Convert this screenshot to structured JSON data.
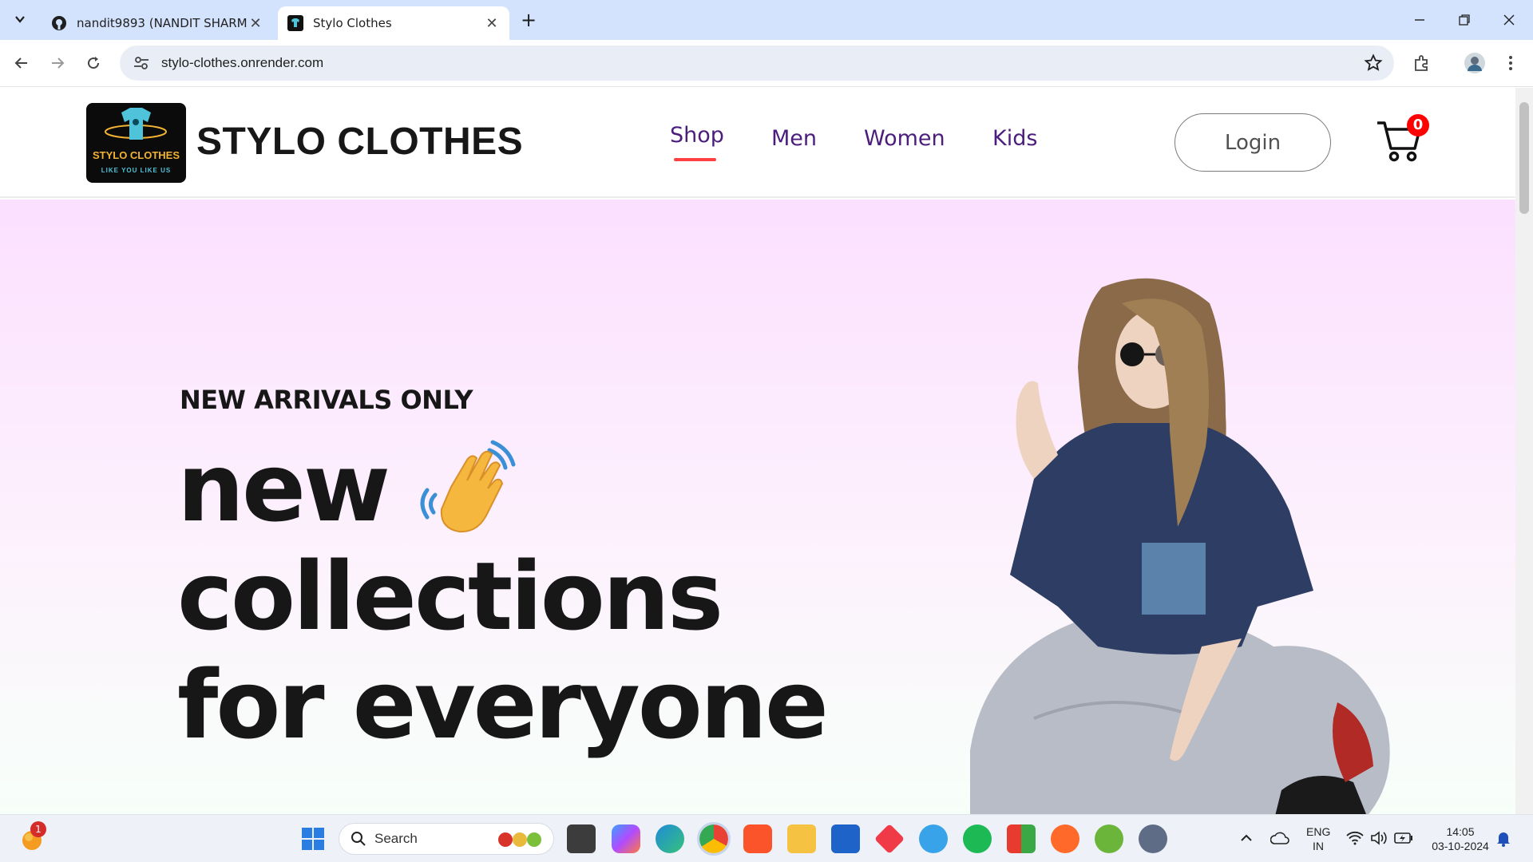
{
  "browser": {
    "tabs": [
      {
        "title": "nandit9893 (NANDIT SHARMA)",
        "active": false
      },
      {
        "title": "Stylo Clothes",
        "active": true
      }
    ],
    "url": "stylo-clothes.onrender.com"
  },
  "site": {
    "logo": {
      "brand": "STYLO CLOTHES",
      "tagline": "LIKE YOU LIKE US"
    },
    "title": "STYLO CLOTHES",
    "nav": [
      "Shop",
      "Men",
      "Women",
      "Kids"
    ],
    "active_nav": "Shop",
    "login_label": "Login",
    "cart_count": "0"
  },
  "hero": {
    "kicker": "NEW ARRIVALS ONLY",
    "line1": "new",
    "line2": "collections",
    "line3": "for everyone"
  },
  "taskbar": {
    "search_placeholder": "Search",
    "notification_badge": "1",
    "lang_top": "ENG",
    "lang_bottom": "IN",
    "time": "14:05",
    "date": "03-10-2024"
  },
  "colors": {
    "nav_text": "#4b1d7d",
    "nav_underline": "#ff4141",
    "cart_badge": "#ff0000",
    "hero_top": "#fbe0ff",
    "hero_bottom": "#f7fff9"
  }
}
